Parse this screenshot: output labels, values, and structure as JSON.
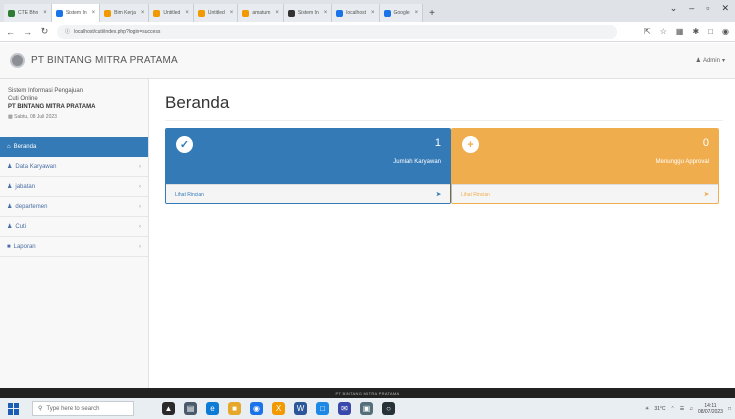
{
  "browser": {
    "tabs": [
      {
        "label": "CTE Bhn",
        "color": "#2e7d32"
      },
      {
        "label": "Sistem In",
        "color": "#1a73e8",
        "active": true
      },
      {
        "label": "Bim Kerja",
        "color": "#f29900"
      },
      {
        "label": "Untitled",
        "color": "#f29900"
      },
      {
        "label": "Untitled",
        "color": "#f29900"
      },
      {
        "label": "amatum",
        "color": "#f29900"
      },
      {
        "label": "Sistem In",
        "color": "#333333"
      },
      {
        "label": "localhost",
        "color": "#1a73e8"
      },
      {
        "label": "Google",
        "color": "#1a73e8"
      }
    ],
    "new_tab": "+",
    "window_controls": [
      "⌄",
      "–",
      "▫",
      "✕"
    ],
    "url": "localhost/cuti/index.php?login=success"
  },
  "app": {
    "brand": "PT BINTANG MITRA PRATAMA",
    "admin": "Admin"
  },
  "sidebar": {
    "system_line1": "Sistem Informasi Pengajuan",
    "system_line2": "Cuti Online",
    "company": "PT BINTANG MITRA PRATAMA",
    "date": "Sabtu, 08 Juli 2023",
    "items": [
      {
        "label": "Beranda",
        "icon": "home-icon",
        "active": true
      },
      {
        "label": "Data Karyawan",
        "icon": "users-icon"
      },
      {
        "label": "jabatan",
        "icon": "user-icon"
      },
      {
        "label": "departemen",
        "icon": "user-icon"
      },
      {
        "label": "Cuti",
        "icon": "user-icon"
      },
      {
        "label": "Laporan",
        "icon": "folder-icon"
      }
    ]
  },
  "main": {
    "title": "Beranda",
    "panels": [
      {
        "count": "1",
        "label": "Jumlah Karyawan",
        "footer": "Lihat Rincian",
        "color": "#337ab7"
      },
      {
        "count": "0",
        "label": "Menunggu Approval",
        "footer": "Lihat Rincian",
        "color": "#f0ad4e"
      }
    ]
  },
  "footer": {
    "text": "PT BINTANG MITRA PRATAMA"
  },
  "taskbar": {
    "search_placeholder": "Type here to search",
    "weather": "31°C",
    "time": "14:11",
    "date": "08/07/2023"
  }
}
